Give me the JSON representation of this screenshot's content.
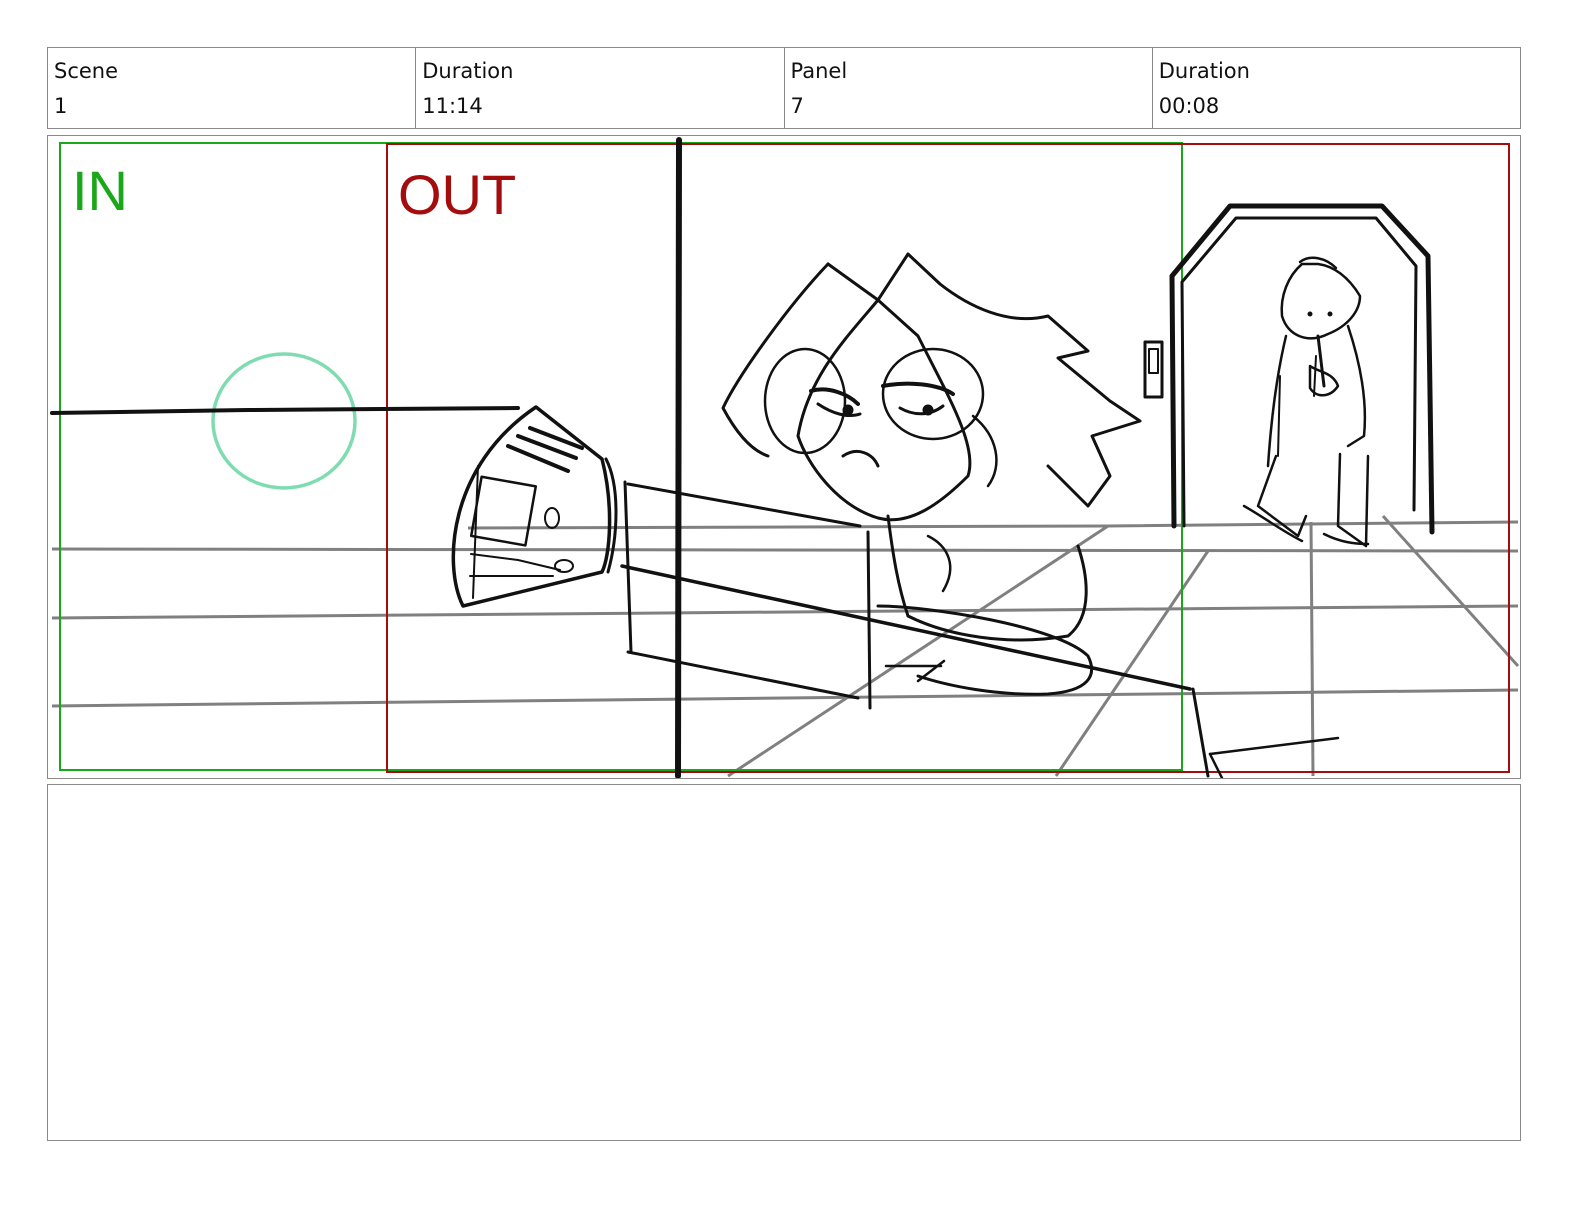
{
  "header": {
    "scene_label": "Scene",
    "scene_value": "1",
    "scene_duration_label": "Duration",
    "scene_duration_value": "11:14",
    "panel_label": "Panel",
    "panel_value": "7",
    "panel_duration_label": "Duration",
    "panel_duration_value": "00:08"
  },
  "panel": {
    "in_label": "IN",
    "out_label": "OUT",
    "colors": {
      "in": "#1aa81a",
      "out": "#a30d0d",
      "guide_circle": "#7fdcb0",
      "sketch": "#111111",
      "floor_grid": "#808080"
    }
  },
  "notes": {
    "text": ""
  }
}
